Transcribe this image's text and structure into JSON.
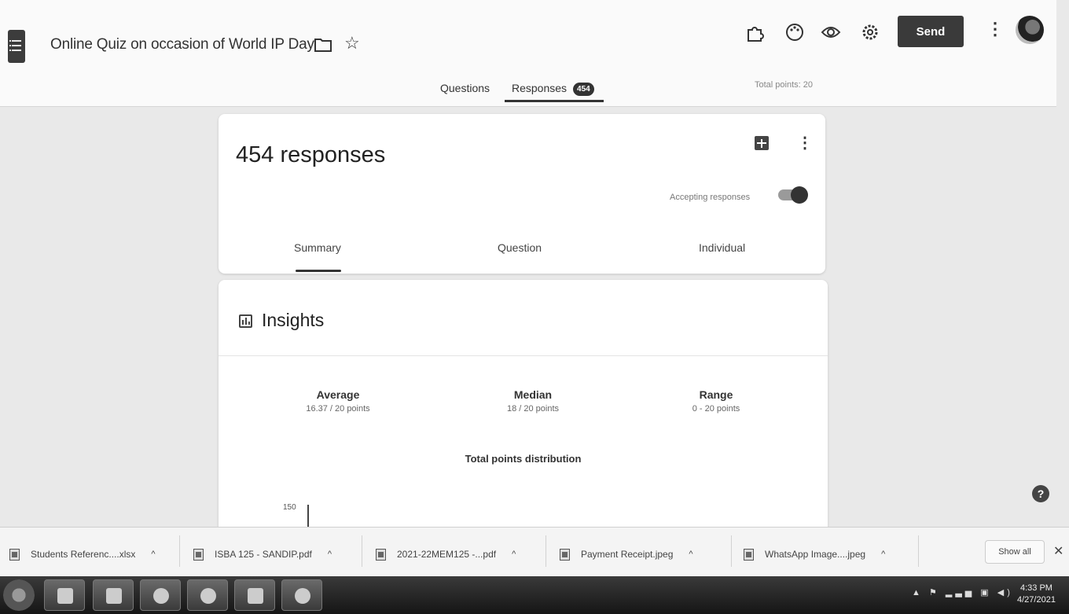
{
  "header": {
    "title": "Online Quiz on occasion of World IP Day",
    "send_label": "Send",
    "tabs": [
      {
        "label": "Questions"
      },
      {
        "label": "Responses",
        "badge": "454"
      }
    ],
    "total_points": "Total points: 20",
    "icons": [
      "addon-icon",
      "palette-icon",
      "preview-eye-icon",
      "settings-gear-icon",
      "more-vert-icon"
    ]
  },
  "responses_card": {
    "title": "454 responses",
    "accepting_label": "Accepting responses",
    "accepting_on": true,
    "subtabs": [
      "Summary",
      "Question",
      "Individual"
    ]
  },
  "insights": {
    "title": "Insights",
    "stats": [
      {
        "label": "Average",
        "value": "16.37 / 20 points"
      },
      {
        "label": "Median",
        "value": "18 / 20 points"
      },
      {
        "label": "Range",
        "value": "0 - 20 points"
      }
    ],
    "distribution_title": "Total points distribution",
    "y_tick": "150"
  },
  "downloads": {
    "items": [
      {
        "name": "Students Referenc....xlsx"
      },
      {
        "name": "ISBA 125 - SANDIP.pdf"
      },
      {
        "name": "2021-22MEM125 -...pdf"
      },
      {
        "name": "Payment Receipt.jpeg"
      },
      {
        "name": "WhatsApp Image....jpeg"
      }
    ],
    "show_all_label": "Show all"
  },
  "taskbar": {
    "time": "4:33 PM",
    "date": "4/27/2021"
  },
  "colors": {
    "accent": "#333333",
    "background": "#e9e9e9",
    "card": "#ffffff"
  }
}
